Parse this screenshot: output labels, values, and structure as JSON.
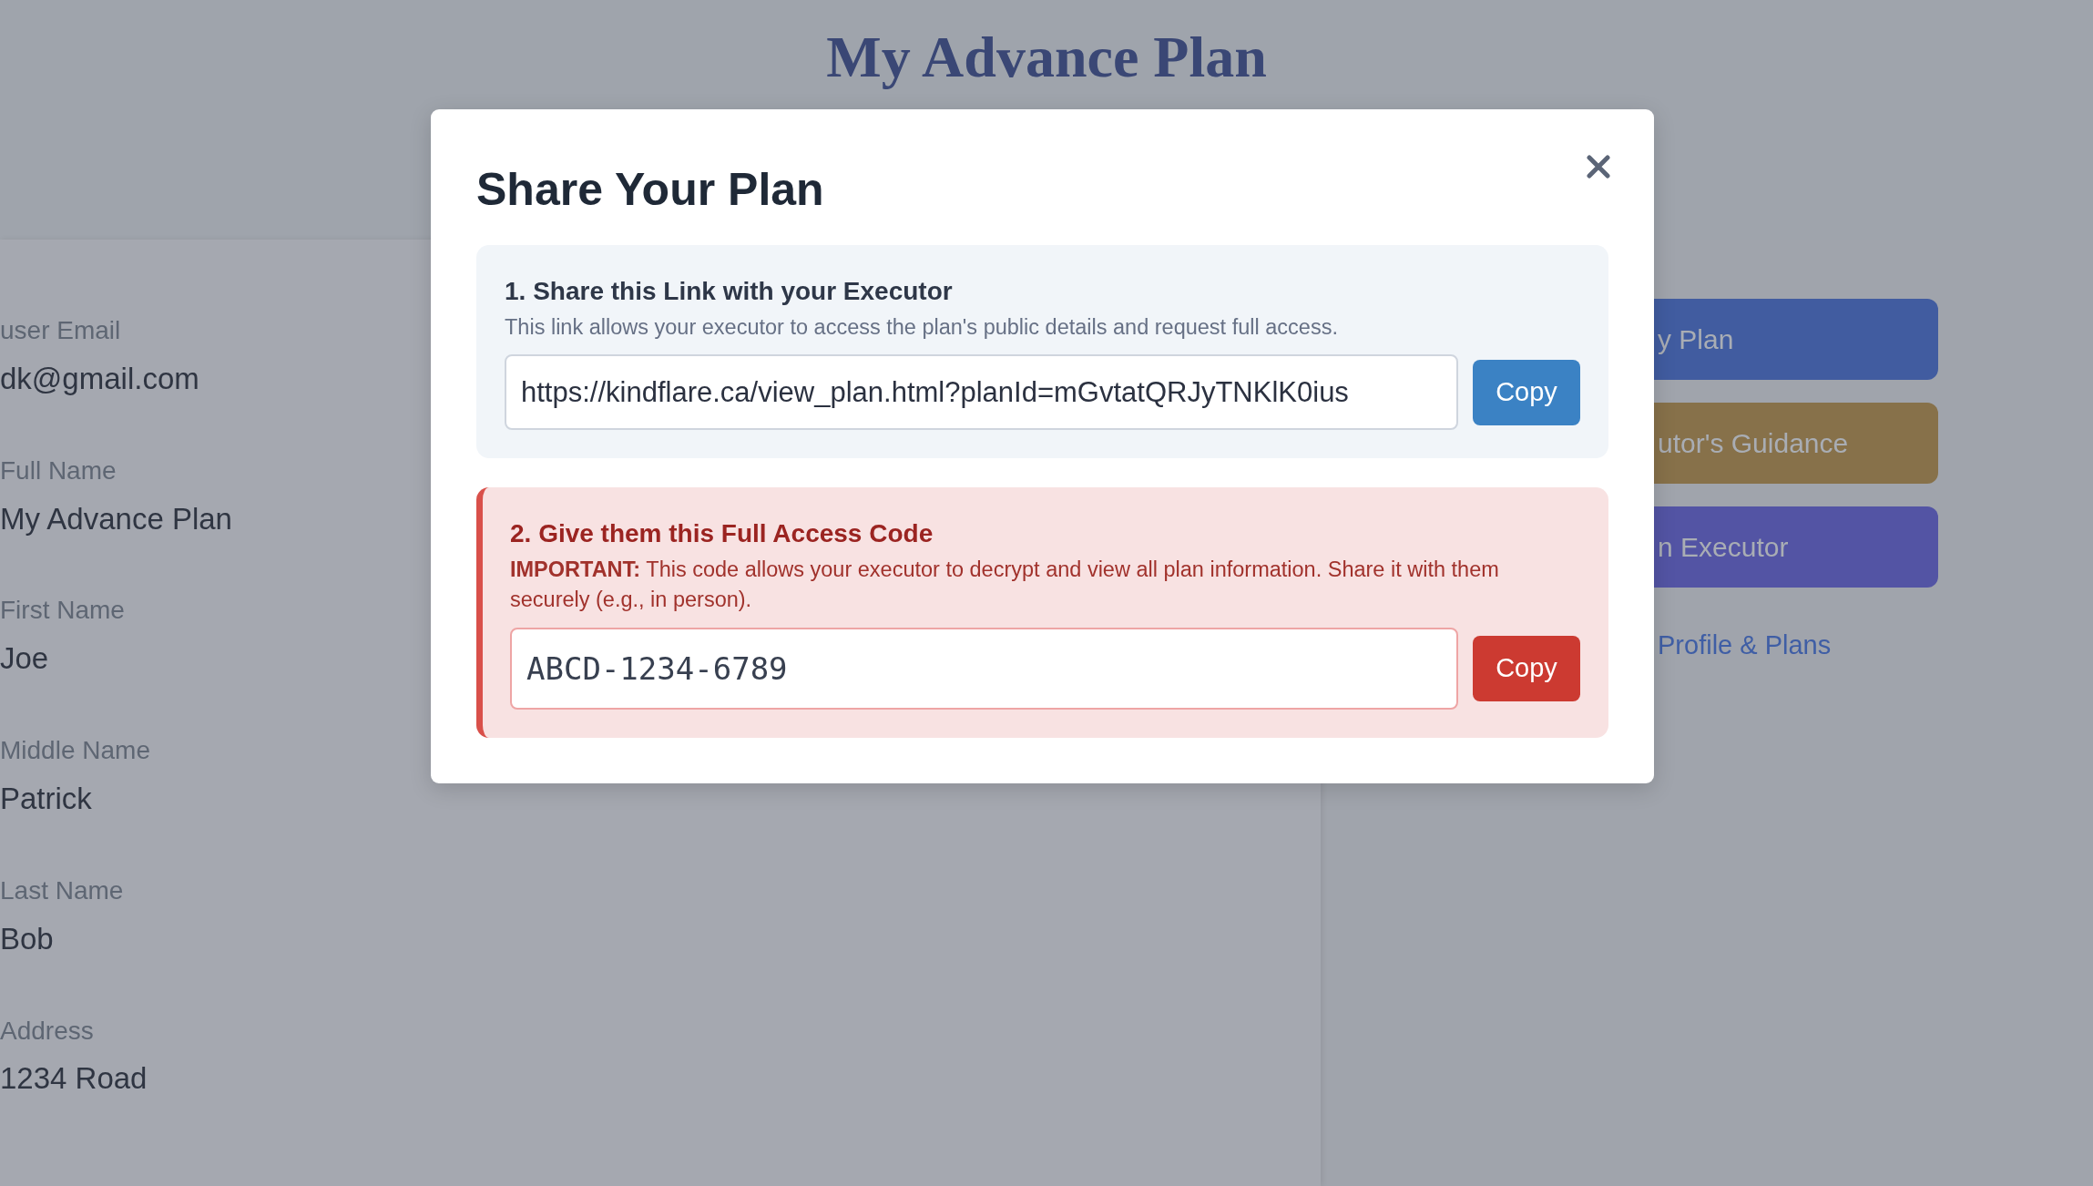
{
  "page": {
    "title": "My Advance Plan"
  },
  "profile_fields": [
    {
      "label": "user Email",
      "value": "dk@gmail.com"
    },
    {
      "label": "Full Name",
      "value": "My Advance Plan"
    },
    {
      "label": "First Name",
      "value": "Joe"
    },
    {
      "label": "Middle Name",
      "value": "Patrick"
    },
    {
      "label": "Last Name",
      "value": "Bob"
    },
    {
      "label": "Address",
      "value": "1234 Road"
    }
  ],
  "actions": [
    {
      "label": "y Plan",
      "color": "#415ca0"
    },
    {
      "label": "utor's Guidance",
      "color": "#87714a"
    },
    {
      "label": "n Executor",
      "color": "#5354a4"
    }
  ],
  "profile_link": "Profile & Plans",
  "modal": {
    "title": "Share Your Plan",
    "sections": [
      {
        "kind": "link",
        "heading": "1. Share this Link with your Executor",
        "description": "This link allows your executor to access the plan's public details and request full access.",
        "value": "https://kindflare.ca/view_plan.html?planId=mGvtatQRJyTNKlK0ius",
        "button": "Copy"
      },
      {
        "kind": "code",
        "heading": "2. Give them this Full Access Code",
        "description": "**IMPORTANT:** This code allows your executor to decrypt and view all plan information. Share it with them securely (e.g., in person).",
        "value": "ABCD-1234-6789",
        "button": "Copy"
      }
    ]
  }
}
